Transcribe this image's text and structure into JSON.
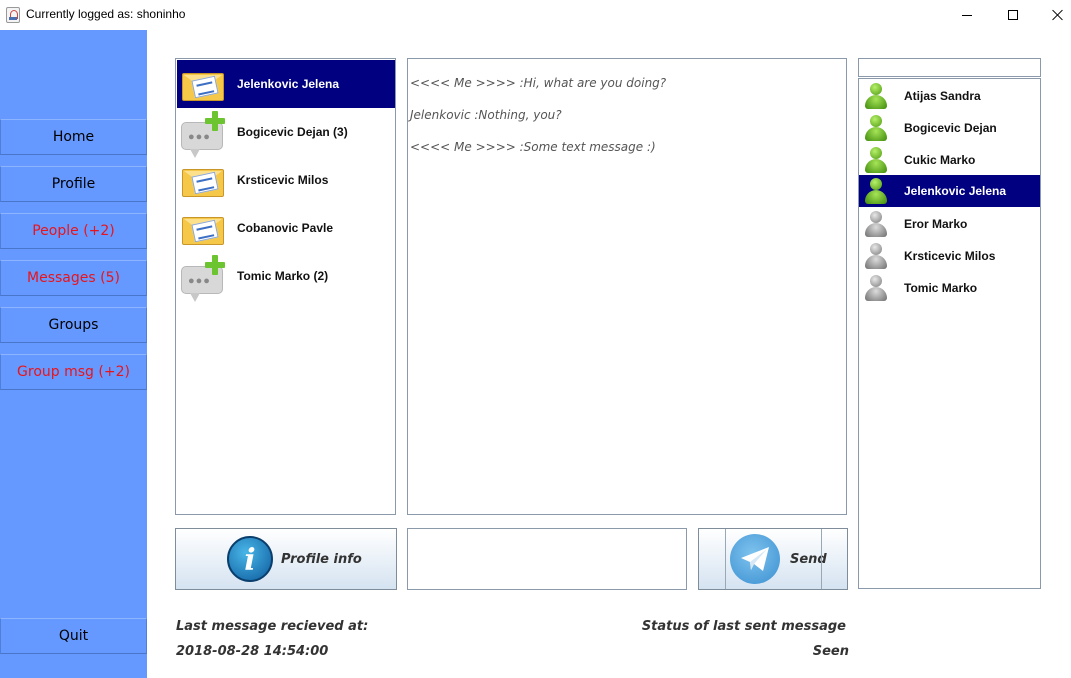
{
  "window": {
    "title": "Currently logged as: shoninho"
  },
  "sidebar": {
    "items": [
      {
        "label": "Home",
        "alert": false
      },
      {
        "label": "Profile",
        "alert": false
      },
      {
        "label": "People (+2)",
        "alert": true
      },
      {
        "label": "Messages (5)",
        "alert": true
      },
      {
        "label": "Groups",
        "alert": false
      },
      {
        "label": "Group msg (+2)",
        "alert": true
      }
    ],
    "quit_label": "Quit",
    "background_color": "#6699ff",
    "alert_color": "#e8141b"
  },
  "conversations": {
    "items": [
      {
        "name": "Jelenkovic Jelena",
        "icon": "envelope-icon",
        "selected": true
      },
      {
        "name": "Bogicevic Dejan (3)",
        "icon": "chat-add-icon",
        "selected": false
      },
      {
        "name": "Krsticevic Milos",
        "icon": "envelope-icon",
        "selected": false
      },
      {
        "name": "Cobanovic Pavle",
        "icon": "envelope-icon",
        "selected": false
      },
      {
        "name": "Tomic Marko (2)",
        "icon": "chat-add-icon",
        "selected": false
      }
    ],
    "selection_color": "#000080"
  },
  "chat": {
    "messages": [
      "<<<< Me >>>> :Hi, what are you doing?",
      "Jelenkovic :Nothing, you?",
      "<<<< Me >>>> :Some text message :)"
    ]
  },
  "controls": {
    "profile_info_label": "Profile info",
    "message_input_value": "",
    "send_label": "Send"
  },
  "users": {
    "search_value": "",
    "items": [
      {
        "name": "Atijas Sandra",
        "online": true,
        "selected": false
      },
      {
        "name": "Bogicevic Dejan",
        "online": true,
        "selected": false
      },
      {
        "name": "Cukic Marko",
        "online": true,
        "selected": false
      },
      {
        "name": "Jelenkovic Jelena",
        "online": true,
        "selected": true
      },
      {
        "name": "Eror Marko",
        "online": false,
        "selected": false
      },
      {
        "name": "Krsticevic Milos",
        "online": false,
        "selected": false
      },
      {
        "name": "Tomic Marko",
        "online": false,
        "selected": false
      }
    ]
  },
  "status": {
    "last_received_label": "Last message recieved at:",
    "last_received_value": "2018-08-28 14:54:00",
    "last_sent_status_label": "Status of last sent message",
    "last_sent_status_value": "Seen"
  }
}
